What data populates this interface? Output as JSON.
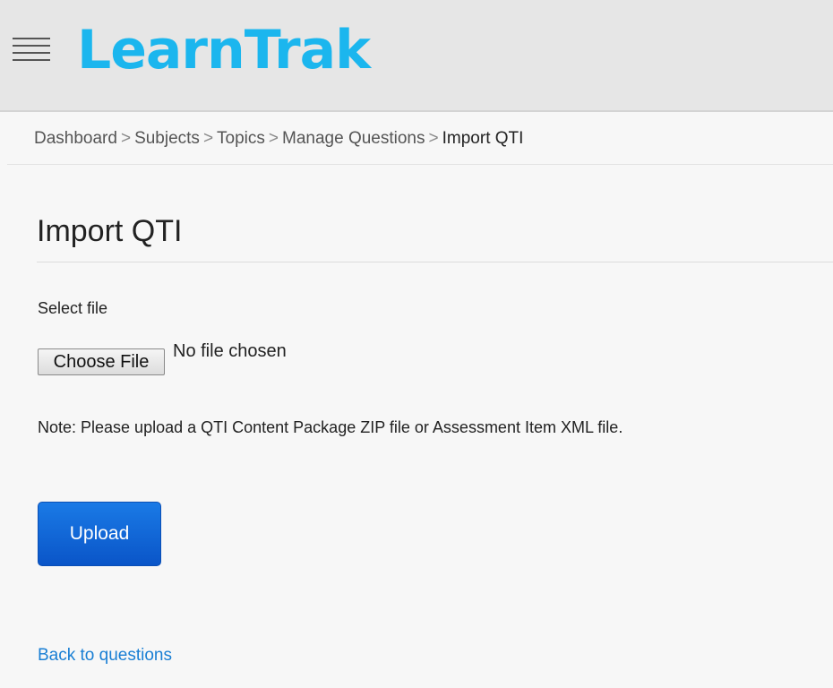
{
  "header": {
    "app_name": "LearnTrak",
    "menu_icon": "hamburger-menu-icon",
    "brand_color": "#1bb6ee"
  },
  "breadcrumb": {
    "separator": ">",
    "items": [
      {
        "label": "Dashboard"
      },
      {
        "label": "Subjects"
      },
      {
        "label": "Topics"
      },
      {
        "label": "Manage Questions"
      },
      {
        "label": "Import QTI"
      }
    ]
  },
  "main": {
    "title": "Import QTI",
    "file_field": {
      "label": "Select file",
      "button_label": "Choose File",
      "status": "No file chosen"
    },
    "note": "Note: Please upload a QTI Content Package ZIP file or Assessment Item XML file.",
    "upload_label": "Upload",
    "back_link": "Back to questions"
  },
  "colors": {
    "primary_button": "#0a5fd6",
    "link": "#1a7fd4",
    "header_bg": "#e6e6e6"
  }
}
